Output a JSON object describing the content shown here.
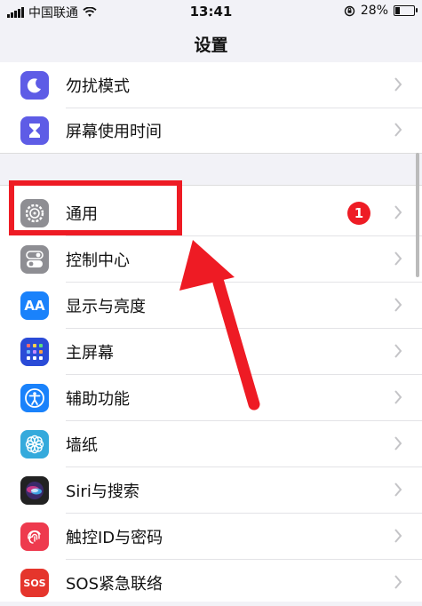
{
  "status_bar": {
    "carrier": "中国联通",
    "time": "13:41",
    "battery_percent": "28%",
    "battery_level": 0.28
  },
  "nav": {
    "title": "设置"
  },
  "group1": [
    {
      "label": "勿扰模式",
      "icon": "moon-icon",
      "color": "#5e5ce6"
    },
    {
      "label": "屏幕使用时间",
      "icon": "hourglass-icon",
      "color": "#5e5ce6"
    }
  ],
  "group2": [
    {
      "label": "通用",
      "icon": "gear-icon",
      "color": "#8e8e93",
      "badge": "1"
    },
    {
      "label": "控制中心",
      "icon": "toggle-icon",
      "color": "#8e8e93"
    },
    {
      "label": "显示与亮度",
      "icon": "text-size-icon",
      "color": "#1a82fb",
      "icon_text": "AA"
    },
    {
      "label": "主屏幕",
      "icon": "home-grid-icon",
      "color": "#2a4bd7"
    },
    {
      "label": "辅助功能",
      "icon": "accessibility-icon",
      "color": "#1a82fb"
    },
    {
      "label": "墙纸",
      "icon": "flower-icon",
      "color": "#35aadc"
    },
    {
      "label": "Siri与搜索",
      "icon": "siri-icon",
      "color": "#222222"
    },
    {
      "label": "触控ID与密码",
      "icon": "fingerprint-icon",
      "color": "#ee3a4e"
    },
    {
      "label": "SOS紧急联络",
      "icon": "sos-icon",
      "color": "#e5352c",
      "icon_text": "SOS"
    }
  ],
  "annotation": {
    "highlight_color": "#ee1b24"
  }
}
